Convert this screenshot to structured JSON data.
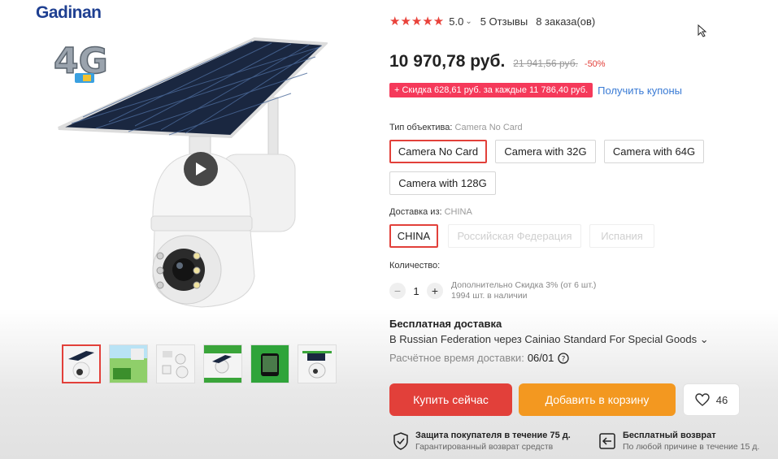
{
  "brand": {
    "name": "Gadinan",
    "badge": "4G"
  },
  "colors": {
    "accent_red": "#e2403a",
    "orange": "#f39820",
    "coupon_pink": "#f5395a",
    "link_blue": "#3a7bd5"
  },
  "gallery": {
    "play_icon": "play-icon",
    "thumbnails": [
      "thumb-1",
      "thumb-2",
      "thumb-3",
      "thumb-4",
      "thumb-5",
      "thumb-6"
    ],
    "active_index": 0
  },
  "rating": {
    "stars": "★★★★★",
    "value": "5.0",
    "reviews": "5 Отзывы",
    "orders": "8 заказа(ов)"
  },
  "price": {
    "current": "10 970,78 руб.",
    "old": "21 941,56 руб.",
    "discount": "-50%"
  },
  "coupon": {
    "badge": "+ Скидка 628,61 руб. за каждые 11 786,40 руб.",
    "link": "Получить купоны"
  },
  "lens_type": {
    "label": "Тип объектива:",
    "selected": "Camera No Card",
    "options": [
      "Camera No Card",
      "Camera with 32G",
      "Camera with 64G",
      "Camera with 128G"
    ]
  },
  "ship_from": {
    "label": "Доставка из:",
    "selected": "CHINA",
    "options": [
      "CHINA",
      "Российская Федерация",
      "Испания"
    ]
  },
  "quantity": {
    "label": "Количество:",
    "value": "1",
    "minus": "−",
    "plus": "+",
    "note_line1": "Дополнительно Скидка 3% (от 6 шт.)",
    "note_line2": "1994 шт. в наличии"
  },
  "shipping": {
    "title": "Бесплатная доставка",
    "method": "В Russian Federation через Cainiao Standard For Special Goods ⌄",
    "eta_label": "Расчётное время доставки:",
    "eta_date": "06/01"
  },
  "actions": {
    "buy": "Купить сейчас",
    "cart": "Добавить в корзину",
    "wish_count": "46"
  },
  "guarantees": {
    "protection_title": "Защита покупателя в течение 75 д.",
    "protection_sub": "Гарантированный возврат средств",
    "return_title": "Бесплатный возврат",
    "return_sub": "По любой причине в течение 15 д."
  }
}
